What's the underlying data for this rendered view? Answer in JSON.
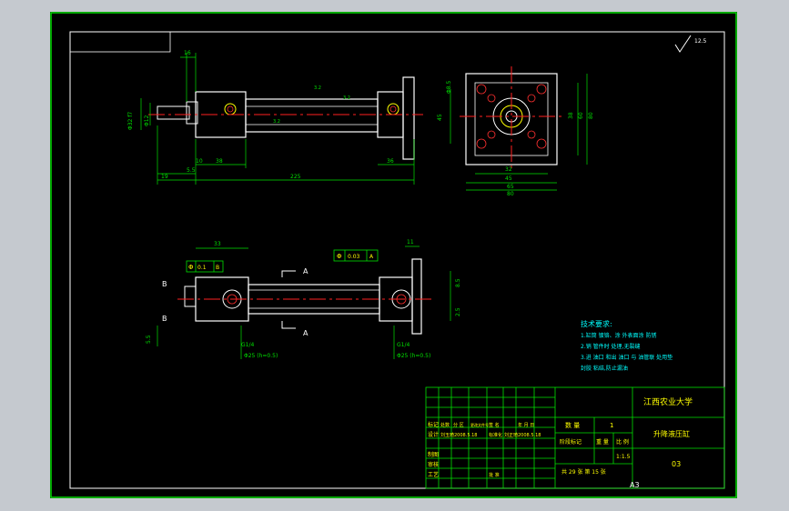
{
  "sheet": {
    "size_code": "A3",
    "roughness_symbol": "12.5"
  },
  "top_view": {
    "dims": [
      "16",
      "38",
      "10",
      "5.5",
      "38",
      "36",
      "225",
      "19"
    ],
    "bore_dim": "Φ32 f7",
    "rod_dim": "Φ12",
    "surface_marks": [
      "3.2",
      "3.2",
      "3.2"
    ]
  },
  "end_view": {
    "dims": [
      "Φ8.5",
      "45",
      "32",
      "45",
      "60",
      "38",
      "65",
      "80",
      "45"
    ]
  },
  "section_view": {
    "dims": [
      "33",
      "11",
      "8.5",
      "2.5",
      "5.5",
      "G1/4",
      "G1/4"
    ],
    "thread_note_left": "Φ25 (h=0.5)",
    "thread_note_right": "Φ25 (h=0.5)",
    "section_marker": "A",
    "tolerance_frame": [
      "Φ",
      "0.03",
      "A"
    ],
    "tolerance_frame_left": [
      "Φ",
      "0.1",
      "B"
    ],
    "datum_b": "B"
  },
  "tech_requirements": {
    "title": "技术要求:",
    "lines": [
      "1.缸筒 镀铬、涂 外表面涂 防锈",
      "2.销 管件时 处理,无裂缝",
      "3.进 油口 和出 油口 与 油管联 处用垫",
      "封胶 粘结,防止漏油"
    ]
  },
  "title_block": {
    "school": "江西农业大学",
    "part_name": "升降液压缸",
    "drawing_no": "03",
    "quantity_label": "数 量",
    "quantity": "1",
    "scale_label": "比 例",
    "scale": "1:1.5",
    "weight_label": "重 量",
    "sheet_info": "共 29 张  第 15 张",
    "row_labels": [
      "标记",
      "设计",
      "制图",
      "审核",
      "工艺"
    ],
    "designer": "刘玉琦2008.5.18",
    "standardizer": "刘正琦2008.5.18",
    "approve_label": "批 准",
    "stage_label": "阶段标记",
    "header_cells": [
      "处数",
      "分 区",
      "更改文件号",
      "签 名",
      "年 月 日"
    ],
    "std_label": "标准化"
  }
}
